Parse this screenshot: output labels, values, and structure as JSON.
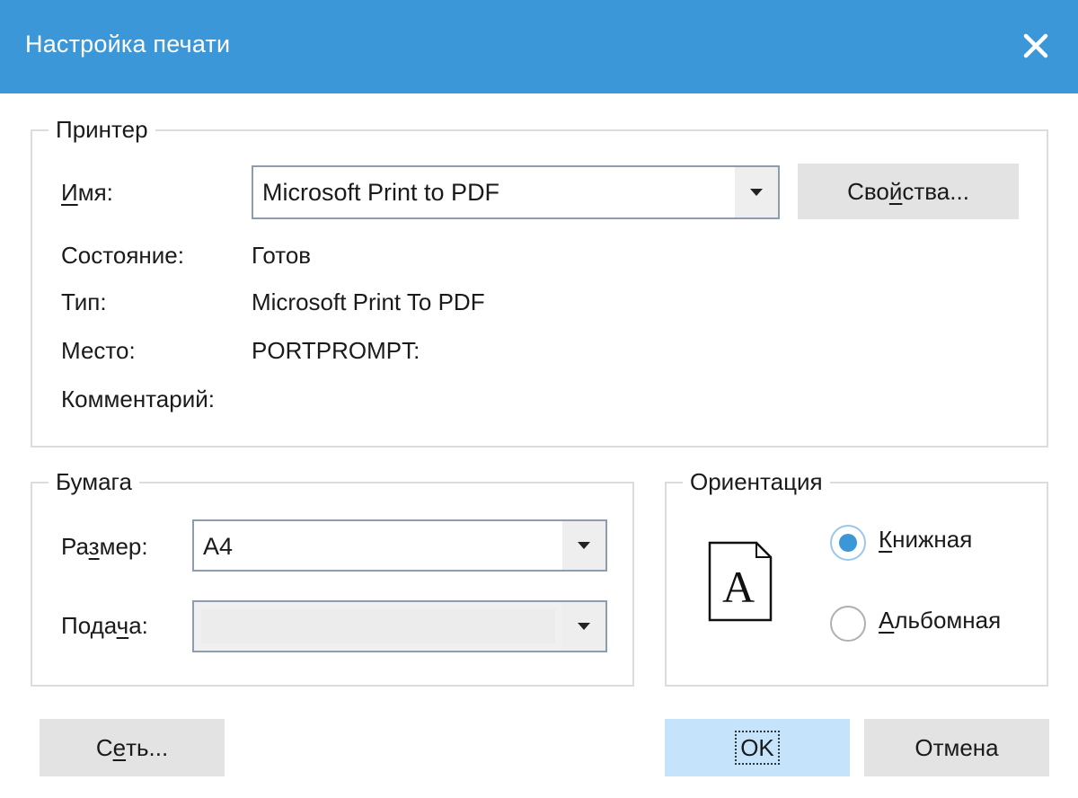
{
  "window": {
    "title": "Настройка печати"
  },
  "printer": {
    "legend": "Принтер",
    "name_label_u": "И",
    "name_label_rest": "мя:",
    "name_value": "Microsoft Print to PDF",
    "properties_pre": "Сво",
    "properties_u": "й",
    "properties_post": "ства...",
    "status_label": "Состояние:",
    "status_value": "Готов",
    "type_label": "Тип:",
    "type_value": "Microsoft Print To PDF",
    "where_label": "Место:",
    "where_value": "PORTPROMPT:",
    "comment_label": "Комментарий:"
  },
  "paper": {
    "legend": "Бумага",
    "size_pre": "Ра",
    "size_u": "з",
    "size_post": "мер:",
    "size_value": "A4",
    "source_pre": "Пода",
    "source_u": "ч",
    "source_post": "а:",
    "source_value": ""
  },
  "orientation": {
    "legend": "Ориентация",
    "portrait_u": "К",
    "portrait_rest": "нижная",
    "landscape_u": "А",
    "landscape_rest": "льбомная",
    "selected": "portrait",
    "page_glyph": "A"
  },
  "buttons": {
    "network_pre": "С",
    "network_u": "е",
    "network_post": "ть...",
    "ok": "OK",
    "cancel": "Отмена"
  },
  "colors": {
    "titlebar": "#3c97d8",
    "accent": "#3c97d8",
    "primary_button": "#c5e4fb"
  }
}
